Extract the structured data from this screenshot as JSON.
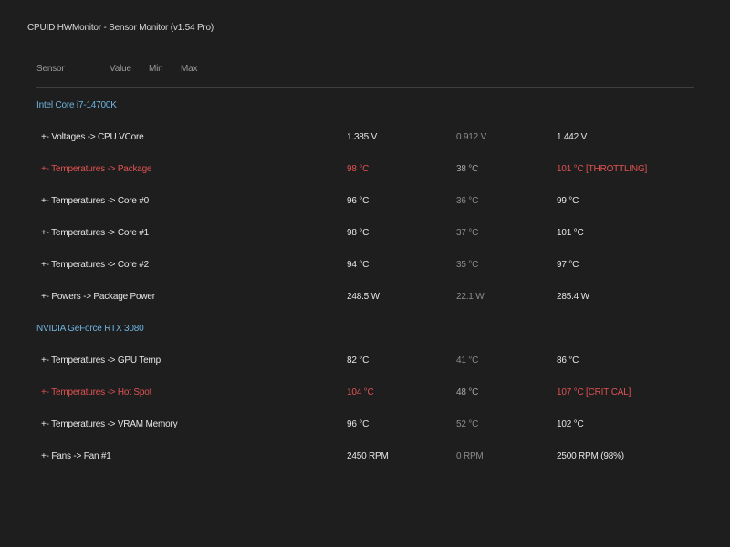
{
  "window": {
    "title": "CPUID HWMonitor - Sensor Monitor (v1.54 Pro)"
  },
  "columns": {
    "sensor": "Sensor",
    "value": "Value",
    "min": "Min",
    "max": "Max"
  },
  "groups": [
    {
      "label": "Intel Core i7-14700K",
      "rows": [
        {
          "name": "+- Voltages -> CPU VCore",
          "value": "1.385 V",
          "min": "0.912 V",
          "max": "1.442 V",
          "alert": false
        },
        {
          "name": "+- Temperatures -> Package",
          "value": "98 °C",
          "min": "38 °C",
          "max": "101 °C [THROTTLING]",
          "alert": true
        },
        {
          "name": "+- Temperatures -> Core #0",
          "value": "96 °C",
          "min": "36 °C",
          "max": "99 °C",
          "alert": false
        },
        {
          "name": "+- Temperatures -> Core #1",
          "value": "98 °C",
          "min": "37 °C",
          "max": "101 °C",
          "alert": false
        },
        {
          "name": "+- Temperatures -> Core #2",
          "value": "94 °C",
          "min": "35 °C",
          "max": "97 °C",
          "alert": false
        },
        {
          "name": "+- Powers -> Package Power",
          "value": "248.5 W",
          "min": "22.1 W",
          "max": "285.4 W",
          "alert": false
        }
      ]
    },
    {
      "label": "NVIDIA GeForce RTX 3080",
      "rows": [
        {
          "name": "+- Temperatures -> GPU Temp",
          "value": "82 °C",
          "min": "41 °C",
          "max": "86 °C",
          "alert": false
        },
        {
          "name": "+- Temperatures -> Hot Spot",
          "value": "104 °C",
          "min": "48 °C",
          "max": "107 °C [CRITICAL]",
          "alert": true
        },
        {
          "name": "+- Temperatures -> VRAM Memory",
          "value": "96 °C",
          "min": "52 °C",
          "max": "102 °C",
          "alert": false
        },
        {
          "name": "+- Fans -> Fan #1",
          "value": "2450 RPM",
          "min": "0 RPM",
          "max": "2500 RPM (98%)",
          "alert": false
        }
      ]
    }
  ]
}
